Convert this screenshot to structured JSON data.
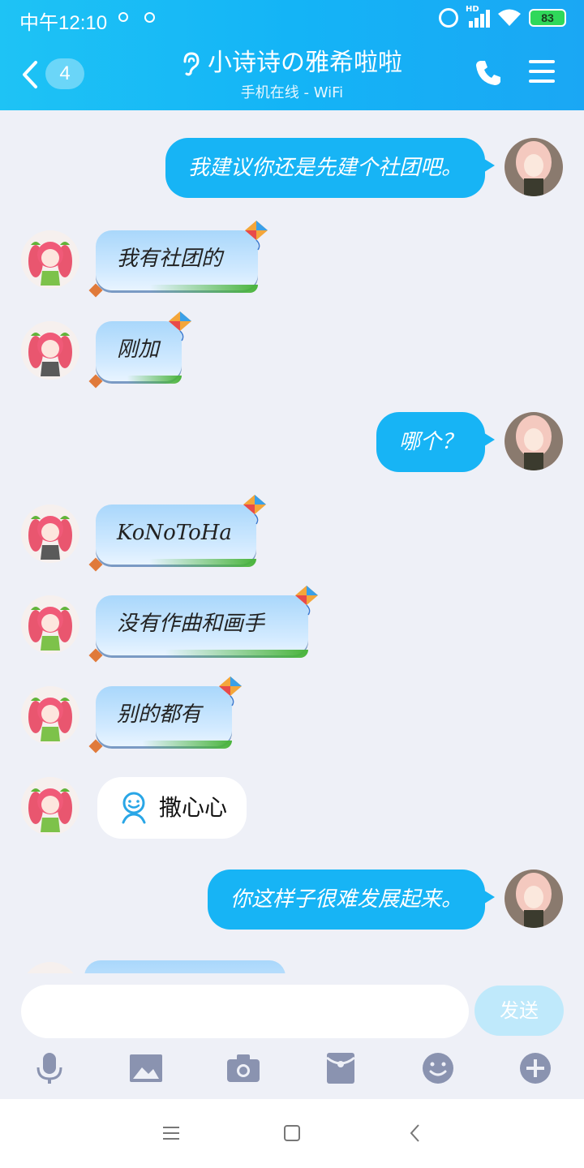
{
  "status_bar": {
    "time": "中午12:10",
    "battery": "83",
    "network": "HD"
  },
  "header": {
    "unread_count": "4",
    "title": "小诗诗の雅希啦啦",
    "subtitle": "手机在线 - WiFi"
  },
  "messages": [
    {
      "side": "right",
      "style": "plain",
      "text": "我建议你还是先建个社团吧。"
    },
    {
      "side": "left",
      "style": "kite",
      "text": "我有社团的"
    },
    {
      "side": "left",
      "style": "kite",
      "text": "刚加"
    },
    {
      "side": "right",
      "style": "plain",
      "text": "哪个？"
    },
    {
      "side": "left",
      "style": "kite",
      "text": "KoNoToHa"
    },
    {
      "side": "left",
      "style": "kite",
      "text": "没有作曲和画手"
    },
    {
      "side": "left",
      "style": "kite",
      "text": "别的都有"
    },
    {
      "side": "left",
      "style": "emoji",
      "text": "撒心心"
    },
    {
      "side": "right",
      "style": "plain",
      "text": "你这样子很难发展起来。"
    }
  ],
  "input": {
    "placeholder": "",
    "send_label": "发送"
  },
  "toolbar": [
    "mic-icon",
    "image-icon",
    "camera-icon",
    "red-packet-icon",
    "emoji-icon",
    "plus-icon"
  ],
  "nav": [
    "menu-icon",
    "home-icon",
    "back-icon"
  ],
  "colors": {
    "header_start": "#1ec3f5",
    "header_end": "#1aa7f4",
    "my_bubble": "#17b4f5",
    "background": "#eef0f7"
  }
}
